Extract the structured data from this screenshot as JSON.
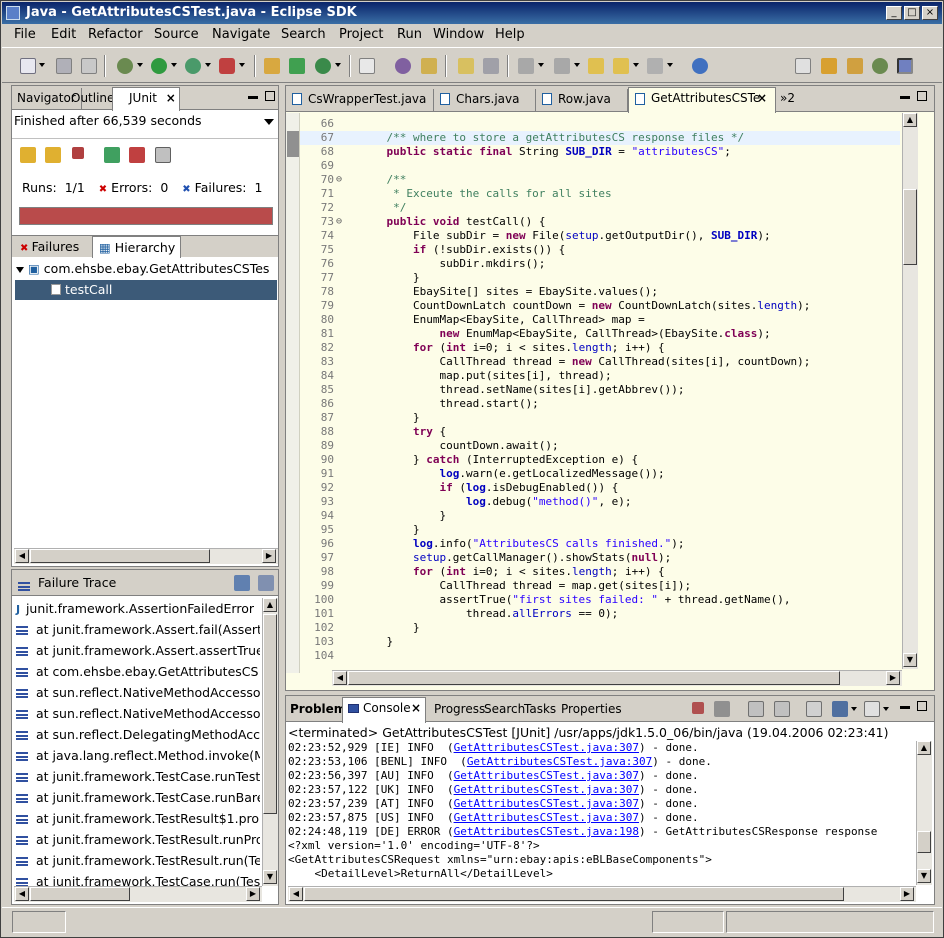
{
  "window": {
    "title": "Java - GetAttributesCSTest.java - Eclipse SDK",
    "controls": [
      "_",
      "□",
      "×"
    ]
  },
  "menu": [
    "File",
    "Edit",
    "Refactor",
    "Source",
    "Navigate",
    "Search",
    "Project",
    "Run",
    "Window",
    "Help"
  ],
  "left_tabs": [
    "Navigator",
    "Outline",
    "JUnit"
  ],
  "junit": {
    "status": "Finished after 66,539 seconds",
    "runs_label": "Runs:",
    "runs_value": "1/1",
    "errors_label": "Errors:",
    "errors_value": "0",
    "failures_label": "Failures:",
    "failures_value": "1",
    "progress": 1.0,
    "progress_color": "#b94b4b",
    "subtabs": [
      "Failures",
      "Hierarchy"
    ],
    "tree": {
      "suite": "com.ehsbe.ebay.GetAttributesCSTes",
      "test": "testCall"
    },
    "trace_title": "Failure Trace",
    "trace": [
      "junit.framework.AssertionFailedError",
      "at junit.framework.Assert.fail(Assert",
      "at junit.framework.Assert.assertTrue",
      "at com.ehsbe.ebay.GetAttributesCS",
      "at sun.reflect.NativeMethodAccesso",
      "at sun.reflect.NativeMethodAccesso",
      "at sun.reflect.DelegatingMethodAcc",
      "at java.lang.reflect.Method.invoke(M",
      "at junit.framework.TestCase.runTest",
      "at junit.framework.TestCase.runBare",
      "at junit.framework.TestResult$1.pro",
      "at junit.framework.TestResult.runPro",
      "at junit.framework.TestResult.run(Te",
      "at junit.framework.TestCase.run(Tes"
    ]
  },
  "editor_tabs": [
    "CsWrapperTest.java",
    "Chars.java",
    "Row.java",
    "GetAttributesCSTe",
    "»2"
  ],
  "editor": {
    "lines": [
      {
        "n": "66",
        "html": ""
      },
      {
        "n": "67",
        "html": "    <span class='cmt'>/** where to store a getAttributesCS response files */</span>"
      },
      {
        "n": "68",
        "html": "    <span class='kw'>public static final</span> String <span class='fld'><b>SUB_DIR</b></span> = <span class='str'>\"attributesCS\"</span>;"
      },
      {
        "n": "69",
        "html": ""
      },
      {
        "n": "70",
        "html": "    <span class='cmt'>/**</span>"
      },
      {
        "n": "71",
        "html": "<span class='cmt'>     * Exceute the calls for all sites</span>"
      },
      {
        "n": "72",
        "html": "<span class='cmt'>     */</span>"
      },
      {
        "n": "73",
        "html": "    <span class='kw'>public void</span> testCall() {"
      },
      {
        "n": "74",
        "html": "        File subDir = <span class='kw'>new</span> File(<span class='fld'>setup</span>.getOutputDir(), <span class='fld'><b>SUB_DIR</b></span>);"
      },
      {
        "n": "75",
        "html": "        <span class='kw'>if</span> (!subDir.exists()) {"
      },
      {
        "n": "76",
        "html": "            subDir.mkdirs();"
      },
      {
        "n": "77",
        "html": "        }"
      },
      {
        "n": "78",
        "html": "        EbaySite[] sites = EbaySite.values();"
      },
      {
        "n": "79",
        "html": "        CountDownLatch countDown = <span class='kw'>new</span> CountDownLatch(sites.<span class='fld'>length</span>);"
      },
      {
        "n": "80",
        "html": "        EnumMap&lt;EbaySite, CallThread&gt; map ="
      },
      {
        "n": "81",
        "html": "            <span class='kw'>new</span> EnumMap&lt;EbaySite, CallThread&gt;(EbaySite.<span class='kw'>class</span>);"
      },
      {
        "n": "82",
        "html": "        <span class='kw'>for</span> (<span class='kw'>int</span> i=0; i &lt; sites.<span class='fld'>length</span>; i++) {"
      },
      {
        "n": "83",
        "html": "            CallThread thread = <span class='kw'>new</span> CallThread(sites[i], countDown);"
      },
      {
        "n": "84",
        "html": "            map.put(sites[i], thread);"
      },
      {
        "n": "85",
        "html": "            thread.setName(sites[i].getAbbrev());"
      },
      {
        "n": "86",
        "html": "            thread.start();"
      },
      {
        "n": "87",
        "html": "        }"
      },
      {
        "n": "88",
        "html": "        <span class='kw'>try</span> {"
      },
      {
        "n": "89",
        "html": "            countDown.await();"
      },
      {
        "n": "90",
        "html": "        } <span class='kw'>catch</span> (InterruptedException e) {"
      },
      {
        "n": "91",
        "html": "            <span class='fld'><b>log</b></span>.warn(e.getLocalizedMessage());"
      },
      {
        "n": "92",
        "html": "            <span class='kw'>if</span> (<span class='fld'><b>log</b></span>.isDebugEnabled()) {"
      },
      {
        "n": "93",
        "html": "                <span class='fld'><b>log</b></span>.debug(<span class='str'>\"method()\"</span>, e);"
      },
      {
        "n": "94",
        "html": "            }"
      },
      {
        "n": "95",
        "html": "        }"
      },
      {
        "n": "96",
        "html": "        <span class='fld'><b>log</b></span>.info(<span class='str'>\"AttributesCS calls finished.\"</span>);"
      },
      {
        "n": "97",
        "html": "        <span class='fld'>setup</span>.getCallManager().showStats(<span class='kw'>null</span>);"
      },
      {
        "n": "98",
        "html": "        <span class='kw'>for</span> (<span class='kw'>int</span> i=0; i &lt; sites.<span class='fld'>length</span>; i++) {"
      },
      {
        "n": "99",
        "html": "            CallThread thread = map.get(sites[i]);"
      },
      {
        "n": "100",
        "html": "            assertTrue(<span class='str'>\"first sites failed: \"</span> + thread.getName(),"
      },
      {
        "n": "101",
        "html": "                thread.<span class='fld'>allErrors</span> == 0);"
      },
      {
        "n": "102",
        "html": "        }"
      },
      {
        "n": "103",
        "html": "    }"
      },
      {
        "n": "104",
        "html": ""
      }
    ]
  },
  "bottom_tabs": [
    "Problems",
    "Console",
    "Progress",
    "Search",
    "Tasks",
    "Properties"
  ],
  "console": {
    "header": "<terminated> GetAttributesCSTest [JUnit] /usr/apps/jdk1.5.0_06/bin/java (19.04.2006 02:23:41)",
    "lines": [
      {
        "pre": "02:23:52,929 [IE] INFO  (",
        "link": "GetAttributesCSTest.java:307",
        "post": ") - done."
      },
      {
        "pre": "02:23:53,106 [BENL] INFO  (",
        "link": "GetAttributesCSTest.java:307",
        "post": ") - done."
      },
      {
        "pre": "02:23:56,397 [AU] INFO  (",
        "link": "GetAttributesCSTest.java:307",
        "post": ") - done."
      },
      {
        "pre": "02:23:57,122 [UK] INFO  (",
        "link": "GetAttributesCSTest.java:307",
        "post": ") - done."
      },
      {
        "pre": "02:23:57,239 [AT] INFO  (",
        "link": "GetAttributesCSTest.java:307",
        "post": ") - done."
      },
      {
        "pre": "02:23:57,875 [US] INFO  (",
        "link": "GetAttributesCSTest.java:307",
        "post": ") - done."
      },
      {
        "pre": "02:24:48,119 [DE] ERROR (",
        "link": "GetAttributesCSTest.java:198",
        "post": ") - GetAttributesCSResponse response"
      },
      {
        "pre": "<?xml version='1.0' encoding='UTF-8'?>",
        "link": "",
        "post": ""
      },
      {
        "pre": "<GetAttributesCSRequest xmlns=\"urn:ebay:apis:eBLBaseComponents\">",
        "link": "",
        "post": ""
      },
      {
        "pre": "    <DetailLevel>ReturnAll</DetailLevel>",
        "link": "",
        "post": ""
      }
    ]
  }
}
